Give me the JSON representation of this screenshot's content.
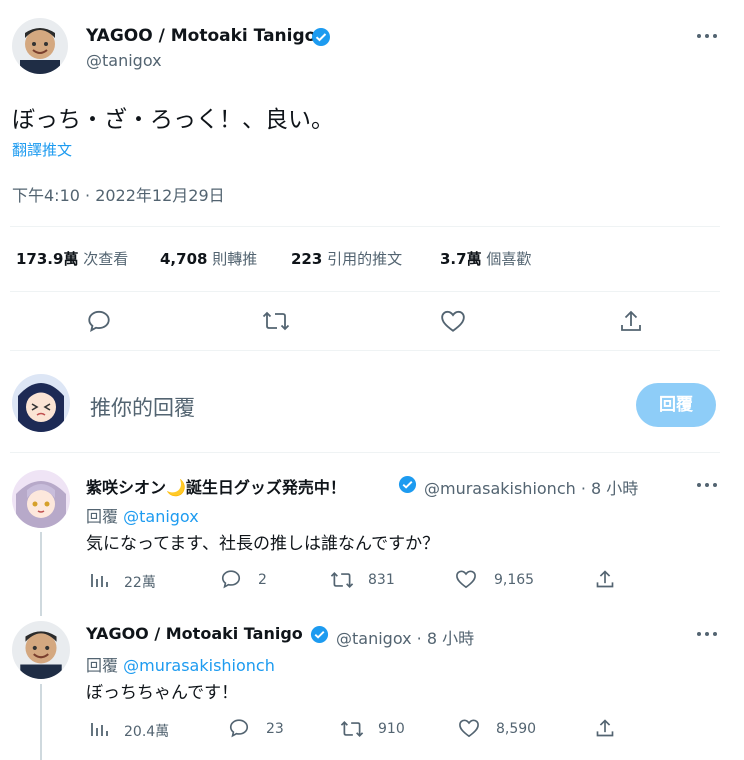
{
  "main_tweet": {
    "display_name": "YAGOO / Motoaki Tanigo",
    "handle": "@tanigox",
    "text": "ぼっち・ざ・ろっく！、良い。",
    "translate_label": "翻譯推文",
    "timestamp": "下午4:10 · 2022年12月29日",
    "stats": [
      {
        "value": "173.9萬",
        "label": "次查看"
      },
      {
        "value": "4,708",
        "label": "則轉推"
      },
      {
        "value": "223",
        "label": "引用的推文"
      },
      {
        "value": "3.7萬",
        "label": "個喜歡"
      }
    ],
    "colors": {
      "verified": "#1d9bf0",
      "link": "#1d9bf0"
    }
  },
  "reply_box": {
    "placeholder": "推你的回覆",
    "button_label": "回覆",
    "button_color": "#8ecdf8"
  },
  "replies": [
    {
      "display_name": "紫咲シオン🌙誕生日グッズ発売中！",
      "handle": "@murasakishionch",
      "time": "8 小時",
      "reply_prefix": "回覆",
      "reply_to": "@tanigox",
      "text": "気になってます、社長の推しは誰なんですか？",
      "views": "22萬",
      "comments": "2",
      "retweets": "831",
      "likes": "9,165"
    },
    {
      "display_name": "YAGOO / Motoaki Tanigo",
      "handle": "@tanigox",
      "time": "8 小時",
      "reply_prefix": "回覆",
      "reply_to": "@murasakishionch",
      "text": "ぼっちちゃんです！",
      "views": "20.4萬",
      "comments": "23",
      "retweets": "910",
      "likes": "8,590"
    }
  ],
  "separator": " · "
}
